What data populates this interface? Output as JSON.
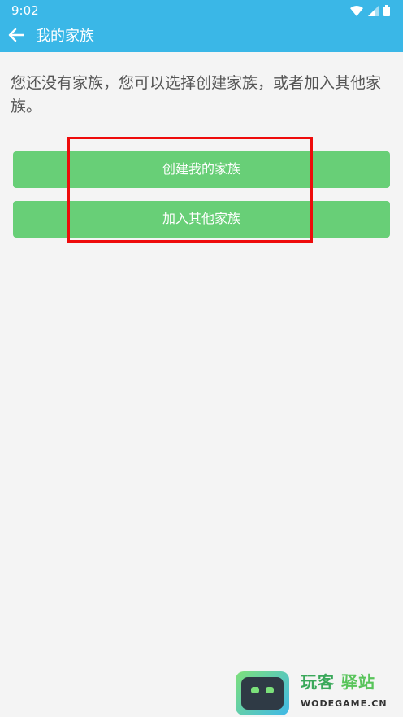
{
  "status_bar": {
    "time": "9:02"
  },
  "app_bar": {
    "title": "我的家族"
  },
  "content": {
    "intro_text": "您还没有家族，您可以选择创建家族，或者加入其他家族。",
    "create_button_label": "创建我的家族",
    "join_button_label": "加入其他家族"
  },
  "watermark": {
    "cn_part1": "玩客",
    "cn_part2": "驿站",
    "en": "WODEGAME.CN"
  },
  "colors": {
    "app_bar": "#3ab7e7",
    "button": "#68cf77",
    "highlight_box": "#ee0b0b",
    "background": "#f4f4f4"
  }
}
